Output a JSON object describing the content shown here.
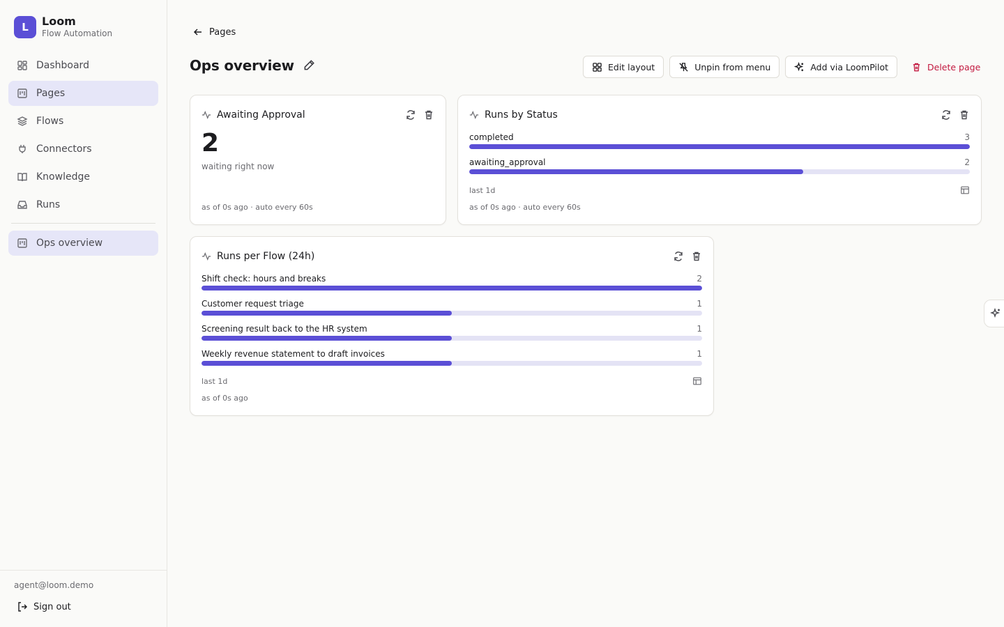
{
  "brand": {
    "initial": "L",
    "name": "Loom",
    "subtitle": "Flow Automation"
  },
  "nav": {
    "items": [
      {
        "label": "Dashboard",
        "icon": "dashboard-icon",
        "active": false
      },
      {
        "label": "Pages",
        "icon": "pages-icon",
        "active": true
      },
      {
        "label": "Flows",
        "icon": "layers-icon",
        "active": false
      },
      {
        "label": "Connectors",
        "icon": "plug-icon",
        "active": false
      },
      {
        "label": "Knowledge",
        "icon": "book-icon",
        "active": false
      },
      {
        "label": "Runs",
        "icon": "inbox-icon",
        "active": false
      }
    ],
    "pinned": [
      {
        "label": "Ops overview",
        "icon": "page-icon",
        "active": true
      }
    ]
  },
  "footer": {
    "email": "agent@loom.demo",
    "signout_label": "Sign out"
  },
  "header": {
    "back_label": "Pages",
    "title": "Ops overview",
    "actions": {
      "edit_layout": "Edit layout",
      "unpin": "Unpin from menu",
      "add_pilot": "Add via LoomPilot",
      "delete": "Delete page"
    }
  },
  "colors": {
    "accent": "#5b4fd6",
    "track": "#e4e3f5",
    "danger": "#c2183f",
    "active_nav": "#e6e6f8"
  },
  "widgets": {
    "awaiting": {
      "title": "Awaiting Approval",
      "value": "2",
      "subtitle": "waiting right now",
      "meta": "as of 0s ago · auto every 60s"
    },
    "status": {
      "title": "Runs by Status",
      "range": "last 1d",
      "meta": "as of 0s ago · auto every 60s",
      "rows": [
        {
          "label": "completed",
          "count": 3
        },
        {
          "label": "awaiting_approval",
          "count": 2
        }
      ]
    },
    "flows": {
      "title": "Runs per Flow (24h)",
      "range": "last 1d",
      "meta": "as of 0s ago",
      "rows": [
        {
          "label": "Shift check: hours and breaks",
          "count": 2
        },
        {
          "label": "Customer request triage",
          "count": 1
        },
        {
          "label": "Screening result back to the HR system",
          "count": 1
        },
        {
          "label": "Weekly revenue statement to draft invoices",
          "count": 1
        }
      ]
    }
  }
}
